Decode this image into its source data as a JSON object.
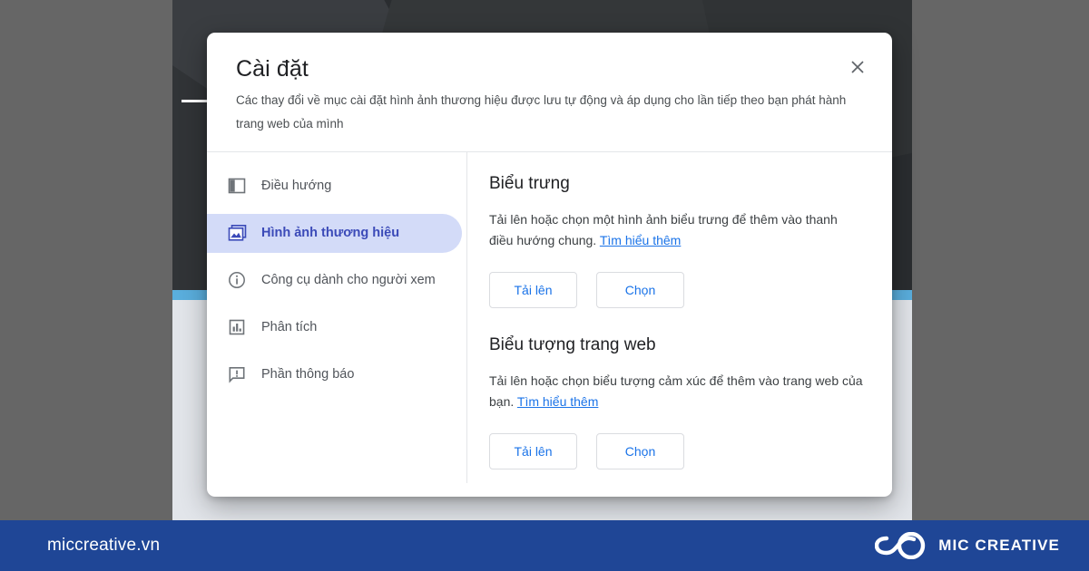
{
  "background": {
    "accent_strip_color": "#5aaedd",
    "dark_color": "#2a2d30",
    "light_panel_color": "#e2e5ea",
    "outer_color": "#666666"
  },
  "dialog": {
    "title": "Cài đặt",
    "subtitle": "Các thay đổi về mục cài đặt hình ảnh thương hiệu được lưu tự động và áp dụng cho lần tiếp theo bạn phát hành trang web của mình",
    "close_label": "×",
    "close_icon": "close-icon"
  },
  "sidebar": {
    "items": [
      {
        "label": "Điều hướng",
        "icon": "navigation-layout-icon",
        "selected": false
      },
      {
        "label": "Hình ảnh thương hiệu",
        "icon": "photo-library-icon",
        "selected": true
      },
      {
        "label": "Công cụ dành cho người xem",
        "icon": "info-circle-icon",
        "selected": false
      },
      {
        "label": "Phân tích",
        "icon": "bar-chart-icon",
        "selected": false
      },
      {
        "label": "Phần thông báo",
        "icon": "announcement-icon",
        "selected": false
      }
    ],
    "selected_bg": "#d3dbf8",
    "selected_fg": "#3b4ab8"
  },
  "content": {
    "sections": [
      {
        "title": "Biểu trưng",
        "desc_before": "Tải lên hoặc chọn một hình ảnh biểu trưng để thêm vào thanh điều hướng chung. ",
        "link": "Tìm hiểu thêm",
        "desc_after": "",
        "upload_label": "Tải lên",
        "choose_label": "Chọn"
      },
      {
        "title": "Biểu tượng trang web",
        "desc_before": "Tải lên hoặc chọn biểu tượng cảm xúc để thêm vào trang web của bạn. ",
        "link": "Tìm hiểu thêm",
        "desc_after": "",
        "upload_label": "Tải lên",
        "choose_label": "Chọn"
      }
    ],
    "link_color": "#1a73e8"
  },
  "banner": {
    "url": "miccreative.vn",
    "brand": "MIC CREATIVE",
    "logo_icon": "infinity-loop-logo",
    "bg_color": "#1f4696"
  }
}
